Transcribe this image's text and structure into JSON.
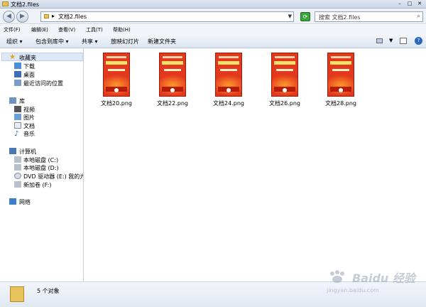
{
  "window": {
    "title": "文档2.files"
  },
  "address": {
    "path": "文档2.files",
    "chevron": "▸"
  },
  "search": {
    "placeholder": "搜索 文档2.files"
  },
  "menu": [
    "文件(F)",
    "编辑(E)",
    "查看(V)",
    "工具(T)",
    "帮助(H)"
  ],
  "toolbar": {
    "organize": "组织 ▾",
    "include": "包含到库中 ▾",
    "share": "共享 ▾",
    "slideshow": "放映幻灯片",
    "newfolder": "新建文件夹"
  },
  "sidebar": {
    "favorites": {
      "label": "收藏夹",
      "items": [
        "下载",
        "桌面",
        "最近访问的位置"
      ]
    },
    "libraries": {
      "label": "库",
      "items": [
        "视频",
        "图片",
        "文档",
        "音乐"
      ]
    },
    "computer": {
      "label": "计算机",
      "items": [
        "本地磁盘 (C:)",
        "本地磁盘 (D:)",
        "DVD 驱动器 (E:) 我的光",
        "新加卷 (F:)"
      ]
    },
    "network": {
      "label": "网络"
    }
  },
  "files": [
    {
      "name": "文档20.png"
    },
    {
      "name": "文档22.png"
    },
    {
      "name": "文档24.png"
    },
    {
      "name": "文档26.png"
    },
    {
      "name": "文档28.png"
    }
  ],
  "status": {
    "count": "5 个对象"
  },
  "watermark": {
    "brand": "Baidu 经验",
    "url": "jingyan.baidu.com"
  },
  "colors": {
    "accent": "#2d66c2",
    "thumb": "#e3371e",
    "sidebar_highlight": "#dde8f6"
  }
}
